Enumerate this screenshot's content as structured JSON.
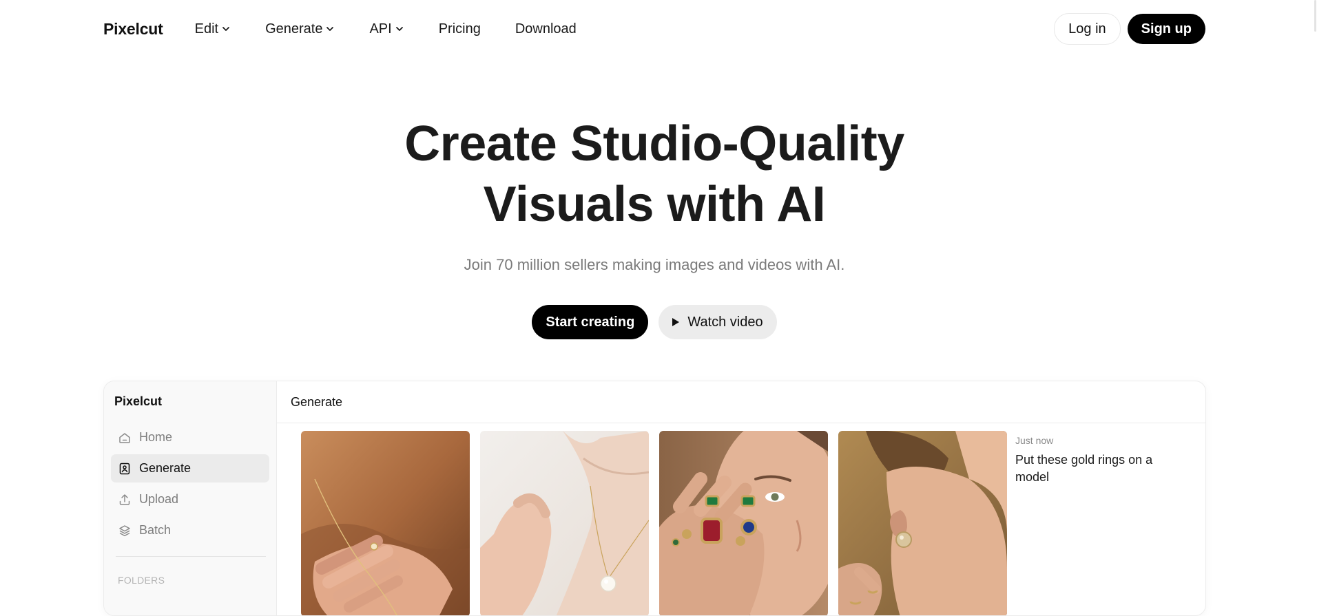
{
  "nav": {
    "logo": "Pixelcut",
    "items": [
      {
        "label": "Edit",
        "dropdown": true
      },
      {
        "label": "Generate",
        "dropdown": true
      },
      {
        "label": "API",
        "dropdown": true
      },
      {
        "label": "Pricing",
        "dropdown": false
      },
      {
        "label": "Download",
        "dropdown": false
      }
    ],
    "login_label": "Log in",
    "signup_label": "Sign up"
  },
  "hero": {
    "title_line1": "Create Studio-Quality",
    "title_line2": "Visuals with AI",
    "subtitle": "Join 70 million sellers making images and videos with AI.",
    "start_label": "Start creating",
    "watch_label": "Watch video"
  },
  "app": {
    "brand": "Pixelcut",
    "sidebar": [
      {
        "label": "Home",
        "icon": "home-icon",
        "active": false
      },
      {
        "label": "Generate",
        "icon": "image-icon",
        "active": true
      },
      {
        "label": "Upload",
        "icon": "upload-icon",
        "active": false
      },
      {
        "label": "Batch",
        "icon": "layers-icon",
        "active": false
      }
    ],
    "folders_label": "FOLDERS",
    "main_title": "Generate",
    "images": [
      {
        "alt": "hand with gold chain bracelet"
      },
      {
        "alt": "neck with pearl pendant necklace"
      },
      {
        "alt": "model wearing gold gemstone rings"
      },
      {
        "alt": "ear with gold stud earring"
      }
    ],
    "chat": {
      "time": "Just now",
      "message": "Put these gold rings on a model"
    }
  },
  "colors": {
    "primary": "#000000",
    "muted_text": "#7a7a7a",
    "secondary_button": "#ececec",
    "active_nav": "#ebebeb"
  }
}
